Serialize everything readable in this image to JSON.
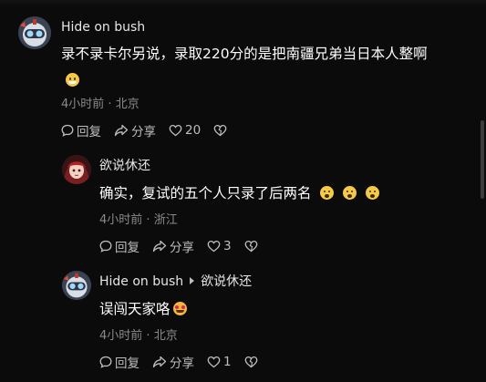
{
  "colors": {
    "background": "#0b0b0b",
    "text": "#ffffff",
    "muted": "#8a8a8a",
    "action": "#bdbdbd",
    "emoji": "#f7c948"
  },
  "comments": [
    {
      "author": "Hide on bush",
      "avatar_icon": "robot-avatar-icon",
      "text": "录不录卡尔另说，录取220分的是把南疆兄弟当日本人整啊",
      "emojis": [
        "grinning-face-emoji"
      ],
      "time": "4小时前",
      "location": "北京",
      "actions": {
        "reply": "回复",
        "share": "分享",
        "likes": "20"
      }
    },
    {
      "author": "欲说休还",
      "avatar_icon": "anime-character-avatar-icon",
      "text": "确实，复试的五个人只录了后两名",
      "emojis": [
        "fearful-face-emoji",
        "fearful-face-emoji",
        "fearful-face-emoji"
      ],
      "time": "4小时前",
      "location": "浙江",
      "actions": {
        "reply": "回复",
        "share": "分享",
        "likes": "3"
      }
    },
    {
      "author": "Hide on bush",
      "reply_to": "欲说休还",
      "avatar_icon": "robot-avatar-icon",
      "text": "误闯天家咯",
      "emojis": [
        "heart-eyes-face-emoji"
      ],
      "time": "4小时前",
      "location": "北京",
      "actions": {
        "reply": "回复",
        "share": "分享",
        "likes": "1"
      }
    }
  ],
  "separator": " · "
}
